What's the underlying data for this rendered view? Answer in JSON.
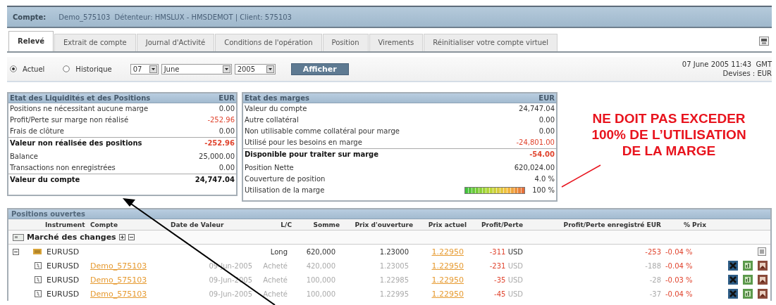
{
  "header": {
    "label": "Compte:",
    "text": "Demo_575103  Détenteur: HMSLUX - HMSDEMOT | Client: 575103"
  },
  "tabs": [
    {
      "label": "Relevé",
      "selected": true
    },
    {
      "label": "Extrait de compte",
      "selected": false
    },
    {
      "label": "Journal d'Activité",
      "selected": false
    },
    {
      "label": "Conditions de l'opération",
      "selected": false
    },
    {
      "label": "Position",
      "selected": false
    },
    {
      "label": "Virements",
      "selected": false
    },
    {
      "label": "Réinitialiser votre compte virtuel",
      "selected": false
    }
  ],
  "filter": {
    "modes": [
      {
        "label": "Actuel",
        "selected": true
      },
      {
        "label": "Historique",
        "selected": false
      }
    ],
    "day": "07",
    "month": "June",
    "year": "2005",
    "button": "Afficher",
    "datetime": "07 June 2005 11:43  GMT",
    "currency": "Devises : EUR"
  },
  "liquidity": {
    "title": "Etat des Liquidités et des Positions",
    "currency": "EUR",
    "rows": [
      {
        "label": "Positions ne nécessitant aucune marge",
        "value": "0.00",
        "negative": false,
        "total": false
      },
      {
        "label": "Profit/Perte sur marge non réalisé",
        "value": "-252.96",
        "negative": true,
        "total": false
      },
      {
        "label": "Frais de clôture",
        "value": "0.00",
        "negative": false,
        "total": false
      },
      {
        "label": "Valeur non réalisée des positions",
        "value": "-252.96",
        "negative": true,
        "total": true
      },
      {
        "label": "Balance",
        "value": "25,000.00",
        "negative": false,
        "total": false
      },
      {
        "label": "Transactions non enregistrées",
        "value": "0.00",
        "negative": false,
        "total": false
      },
      {
        "label": "Valeur du compte",
        "value": "24,747.04",
        "negative": false,
        "total": true
      }
    ]
  },
  "margins": {
    "title": "Etat des marges",
    "currency": "EUR",
    "rows": [
      {
        "kind": "value",
        "label": "Valeur du compte",
        "value": "24,747.04",
        "negative": false,
        "total": false
      },
      {
        "kind": "value",
        "label": "Autre collatéral",
        "value": "0.00",
        "negative": false,
        "total": false
      },
      {
        "kind": "value",
        "label": "Non utilisable comme collatéral pour marge",
        "value": "0.00",
        "negative": false,
        "total": false
      },
      {
        "kind": "value",
        "label": "Utilisé pour les besoins en marge",
        "value": "-24,801.00",
        "negative": true,
        "total": false
      },
      {
        "kind": "value",
        "label": "Disponible pour traiter sur marge",
        "value": "-54.00",
        "negative": true,
        "total": true
      },
      {
        "kind": "value",
        "label": "Position Nette",
        "value": "620,024.00",
        "negative": false,
        "total": false
      },
      {
        "kind": "value",
        "label": "Couverture de position",
        "value": "4.0 %",
        "negative": false,
        "total": false
      },
      {
        "kind": "gauge",
        "label": "Utilisation de la marge",
        "value": "100 %",
        "negative": false,
        "total": false,
        "level": 1
      }
    ]
  },
  "annotation": {
    "lines": [
      "NE DOIT PAS EXCEDER",
      "100% DE L’UTILISATION",
      "DE LA MARGE"
    ]
  },
  "positions": {
    "title": "Positions ouvertes",
    "columns": [
      "Instrument",
      "Compte",
      "Date de Valeur",
      "L/C",
      "Somme",
      "Prix d'ouverture",
      "Prix actuel",
      "Profit/Perte",
      "Profit/Perte enregistré EUR",
      "% Prix"
    ],
    "groups": [
      {
        "label": "Marché des changes",
        "children": [
          {
            "instrument": "EURUSD",
            "expanded": true,
            "side": "Long",
            "amount": "620,000",
            "open": "1.23000",
            "current": "1.22950",
            "pl": "-311",
            "pl_currency": "USD",
            "pl_eur": "-253",
            "pct": "-0.04 %",
            "children": [
              {
                "instrument": "EURUSD",
                "account": "Demo_575103",
                "date": "09-Jun-2005",
                "side": "Acheté",
                "amount": "420,000",
                "open": "1.23005",
                "current": "1.22950",
                "pl": "-231",
                "pl_currency": "USD",
                "pl_eur": "-188",
                "pct": "-0.04 %"
              },
              {
                "instrument": "EURUSD",
                "account": "Demo_575103",
                "date": "09-Jun-2005",
                "side": "Acheté",
                "amount": "100,000",
                "open": "1.22985",
                "current": "1.22950",
                "pl": "-35",
                "pl_currency": "USD",
                "pl_eur": "-28",
                "pct": "-0.03 %"
              },
              {
                "instrument": "EURUSD",
                "account": "Demo_575103",
                "date": "09-Jun-2005",
                "side": "Acheté",
                "amount": "100,000",
                "open": "1.22995",
                "current": "1.22950",
                "pl": "-45",
                "pl_currency": "USD",
                "pl_eur": "-37",
                "pct": "-0.04 %"
              }
            ]
          }
        ]
      }
    ]
  }
}
